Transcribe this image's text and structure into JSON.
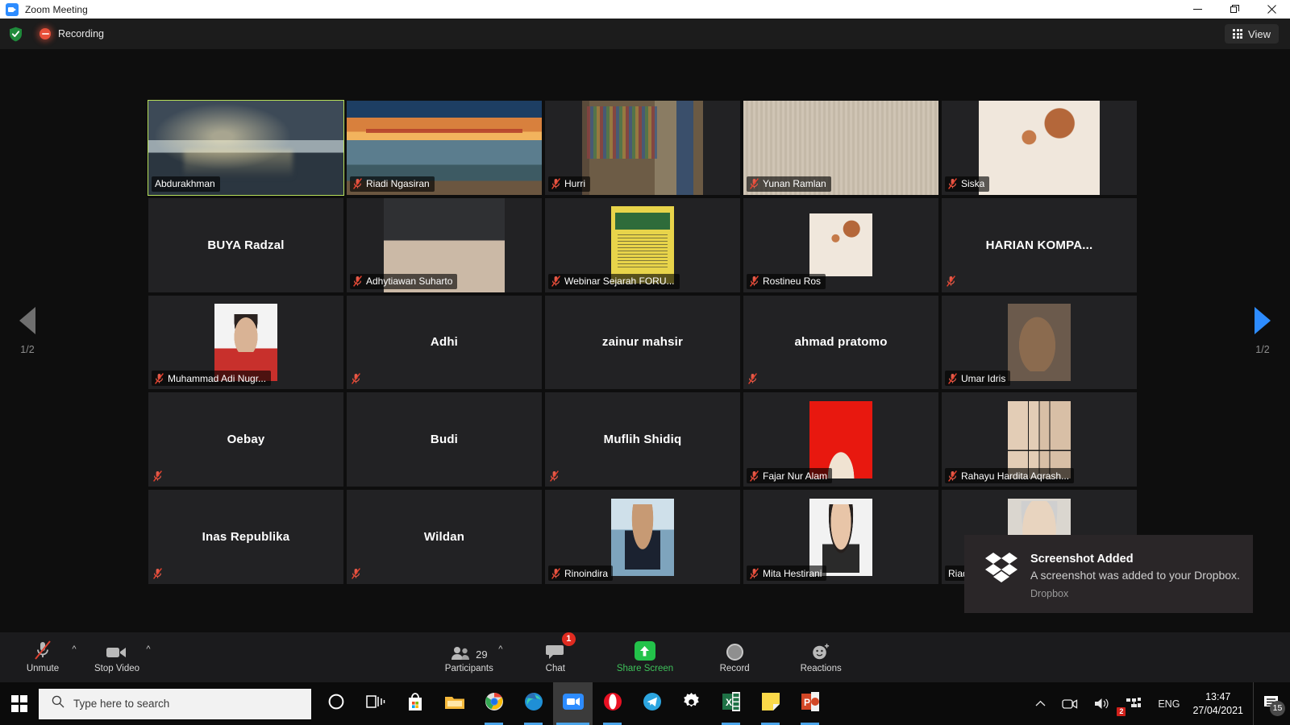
{
  "window": {
    "title": "Zoom Meeting",
    "app_icon": "zoom-camera-icon",
    "minimize_label": "—",
    "restore_label": "❐",
    "close_label": "✕"
  },
  "topbar": {
    "encryption_icon": "shield-check-icon",
    "recording_icon": "recording-dot-icon",
    "recording_label": "Recording",
    "view_label": "View",
    "view_icon": "grid-view-icon"
  },
  "pager": {
    "left_icon": "chevron-left-page-icon",
    "right_icon": "chevron-right-page-icon",
    "left_page": "1/2",
    "right_page": "1/2"
  },
  "grid": {
    "tiles": [
      {
        "name": "Abdurakhman",
        "muted": false,
        "active_speaker": true,
        "video": true,
        "media": "v-city",
        "display": "cam-full",
        "label_style": "bare"
      },
      {
        "name": "Riadi Ngasiran",
        "muted": true,
        "active_speaker": false,
        "video": true,
        "media": "v-bridge",
        "display": "cam-full",
        "label_style": "strip"
      },
      {
        "name": "Hurri",
        "muted": true,
        "active_speaker": false,
        "video": true,
        "media": "v-books",
        "display": "cam-center",
        "label_style": "strip"
      },
      {
        "name": "Yunan Ramlan",
        "muted": true,
        "active_speaker": false,
        "video": true,
        "media": "v-wall",
        "display": "cam-full",
        "label_style": "strip"
      },
      {
        "name": "Siska",
        "muted": true,
        "active_speaker": false,
        "video": true,
        "media": "v-hijab",
        "display": "cam-center",
        "label_style": "strip"
      },
      {
        "name": "BUYA Radzal",
        "initials_text": "BUYA Radzal",
        "muted": false,
        "active_speaker": false,
        "video": false,
        "label_style": "none"
      },
      {
        "name": "Adhytiawan Suharto",
        "muted": true,
        "active_speaker": false,
        "video": true,
        "media": "v-selfie",
        "display": "cam-center",
        "label_style": "strip"
      },
      {
        "name": "Webinar Sejarah FORU...",
        "muted": true,
        "active_speaker": false,
        "video": true,
        "media": "v-poster",
        "display": "avatar-tall",
        "label_style": "strip"
      },
      {
        "name": "Rostineu Ros",
        "muted": true,
        "active_speaker": false,
        "video": true,
        "media": "v-hijab",
        "display": "avatar",
        "label_style": "strip"
      },
      {
        "name": "",
        "initials_text": "HARIAN  KOMPA...",
        "muted": true,
        "active_speaker": false,
        "video": false,
        "label_style": "icon-only"
      },
      {
        "name": "Muhammad Adi Nugr...",
        "muted": true,
        "active_speaker": false,
        "video": true,
        "media": "v-idphoto",
        "display": "avatar-tall",
        "label_style": "strip"
      },
      {
        "name": "",
        "initials_text": "Adhi",
        "muted": true,
        "active_speaker": false,
        "video": false,
        "label_style": "icon-only"
      },
      {
        "name": "",
        "initials_text": "zainur mahsir",
        "muted": false,
        "active_speaker": false,
        "video": false,
        "label_style": "none"
      },
      {
        "name": "",
        "initials_text": "ahmad pratomo",
        "muted": true,
        "active_speaker": false,
        "video": false,
        "label_style": "icon-only"
      },
      {
        "name": "Umar Idris",
        "muted": true,
        "active_speaker": false,
        "video": true,
        "media": "v-glasses",
        "display": "avatar-tall",
        "label_style": "strip"
      },
      {
        "name": "",
        "initials_text": "Oebay",
        "muted": true,
        "active_speaker": false,
        "video": false,
        "label_style": "icon-only"
      },
      {
        "name": "",
        "initials_text": "Budi",
        "muted": false,
        "active_speaker": false,
        "video": false,
        "label_style": "none"
      },
      {
        "name": "",
        "initials_text": "Muflih Shidiq",
        "muted": true,
        "active_speaker": false,
        "video": false,
        "label_style": "icon-only"
      },
      {
        "name": "Fajar Nur Alam",
        "muted": true,
        "active_speaker": false,
        "video": true,
        "media": "v-red",
        "display": "avatar-tall",
        "label_style": "strip"
      },
      {
        "name": "Rahayu Hardita Aqrash...",
        "muted": true,
        "active_speaker": false,
        "video": true,
        "media": "v-collage",
        "display": "avatar-tall",
        "label_style": "strip"
      },
      {
        "name": "",
        "initials_text": "Inas Republika",
        "muted": true,
        "active_speaker": false,
        "video": false,
        "label_style": "icon-only"
      },
      {
        "name": "",
        "initials_text": "Wildan",
        "muted": true,
        "active_speaker": false,
        "video": false,
        "label_style": "icon-only"
      },
      {
        "name": "Rinoindira",
        "muted": true,
        "active_speaker": false,
        "video": true,
        "media": "v-suit",
        "display": "avatar-tall",
        "label_style": "strip"
      },
      {
        "name": "Mita Hestirani",
        "muted": true,
        "active_speaker": false,
        "video": true,
        "media": "v-woman",
        "display": "avatar-tall",
        "label_style": "strip"
      },
      {
        "name": "Riadi N",
        "muted": false,
        "active_speaker": false,
        "video": true,
        "media": "v-elder",
        "display": "avatar-tall",
        "label_style": "strip"
      }
    ]
  },
  "toolbar": {
    "unmute_label": "Unmute",
    "unmute_icon": "microphone-muted-icon",
    "stop_video_label": "Stop Video",
    "stop_video_icon": "video-camera-icon",
    "participants_label": "Participants",
    "participants_icon": "people-icon",
    "participants_count": "29",
    "chat_label": "Chat",
    "chat_icon": "chat-bubble-icon",
    "chat_badge": "1",
    "share_label": "Share Screen",
    "share_icon": "share-up-arrow-icon",
    "record_label": "Record",
    "record_icon": "record-circle-icon",
    "reactions_label": "Reactions",
    "reactions_icon": "smiley-plus-icon",
    "caret_icon": "chevron-up-icon",
    "share_color": "#23c24a",
    "badge_color": "#e02b20"
  },
  "toast": {
    "icon": "dropbox-icon",
    "title": "Screenshot Added",
    "body": "A screenshot was added to your Dropbox.",
    "source": "Dropbox"
  },
  "taskbar": {
    "start_icon": "windows-start-icon",
    "search_placeholder": "Type here to search",
    "search_icon": "search-icon",
    "apps": [
      {
        "icon": "cortana-icon",
        "name": "cortana",
        "state": "idle"
      },
      {
        "icon": "task-view-icon",
        "name": "task-view",
        "state": "idle"
      },
      {
        "icon": "microsoft-store-icon",
        "name": "microsoft-store",
        "state": "idle"
      },
      {
        "icon": "file-explorer-icon",
        "name": "file-explorer",
        "state": "idle"
      },
      {
        "icon": "chrome-icon",
        "name": "google-chrome",
        "state": "running"
      },
      {
        "icon": "edge-icon",
        "name": "microsoft-edge",
        "state": "running"
      },
      {
        "icon": "zoom-icon",
        "name": "zoom",
        "state": "active"
      },
      {
        "icon": "opera-icon",
        "name": "opera",
        "state": "running"
      },
      {
        "icon": "telegram-icon",
        "name": "telegram",
        "state": "idle"
      },
      {
        "icon": "settings-gear-icon",
        "name": "settings",
        "state": "idle"
      },
      {
        "icon": "excel-icon",
        "name": "microsoft-excel",
        "state": "running"
      },
      {
        "icon": "sticky-notes-icon",
        "name": "sticky-notes",
        "state": "running"
      },
      {
        "icon": "powerpoint-icon",
        "name": "microsoft-powerpoint",
        "state": "running"
      }
    ],
    "tray": {
      "overflow_icon": "chevron-up-icon",
      "camera_icon": "camera-privacy-icon",
      "volume_icon": "speaker-volume-icon",
      "network_icon": "network-icon",
      "network_badge": "2",
      "language": "ENG",
      "time": "13:47",
      "date": "27/04/2021",
      "notification_icon": "action-center-icon",
      "notification_count": "15"
    }
  }
}
